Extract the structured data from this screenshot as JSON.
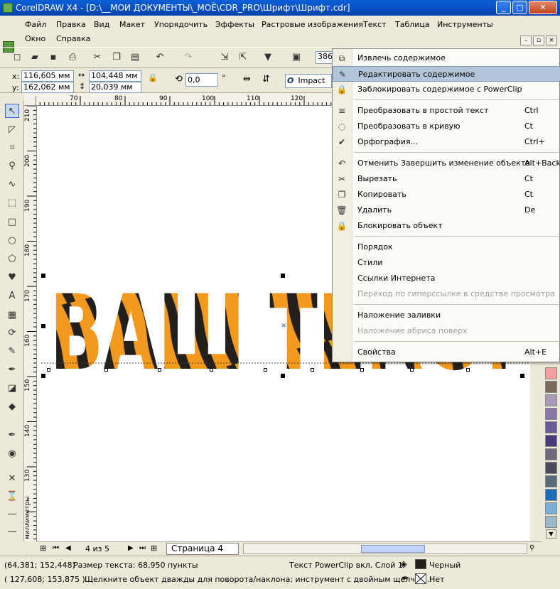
{
  "window": {
    "title": "CorelDRAW X4 - [D:\\__МОИ ДОКУМЕНТЫ\\_МОЁ\\CDR_PRO\\Шрифт\\Шрифт.cdr]"
  },
  "menu": [
    "Файл",
    "Правка",
    "Вид",
    "Макет",
    "Упорядочить",
    "Эффекты",
    "Растровые изображения",
    "Текст",
    "Таблица",
    "Инструменты",
    "Окно",
    "Справка"
  ],
  "toolbar": {
    "zoom": "386"
  },
  "props": {
    "x_label": "x:",
    "x_val": "116,605 мм",
    "y_label": "y:",
    "y_val": "162,062 мм",
    "w_val": "104,448 мм",
    "h_val": "20,039 мм",
    "angle": "0,0",
    "deg": "°",
    "font": "Impact"
  },
  "ruler": {
    "h": [
      "70",
      "80",
      "90",
      "100",
      "110",
      "120"
    ],
    "v": [
      "210",
      "200",
      "190",
      "180",
      "170",
      "160",
      "150",
      "140",
      "130"
    ],
    "unit": "миллиметры"
  },
  "canvas": {
    "text": "ВАШ ТЕКСТ"
  },
  "context_menu": [
    {
      "label": "Извлечь содержимое",
      "shortcut": "",
      "icon": "extract-icon",
      "disabled": false
    },
    {
      "label": "Редактировать содержимое",
      "shortcut": "",
      "icon": "edit-contents-icon",
      "disabled": false,
      "highlight": true
    },
    {
      "label": "Заблокировать содержимое с PowerClip",
      "shortcut": "",
      "icon": "lock-contents-icon",
      "disabled": false
    },
    {
      "sep": true
    },
    {
      "label": "Преобразовать в простой текст",
      "shortcut": "Ctrl",
      "icon": "text-convert-icon",
      "disabled": false
    },
    {
      "label": "Преобразовать в кривую",
      "shortcut": "Ct",
      "icon": "curve-icon",
      "disabled": false
    },
    {
      "label": "Орфография...",
      "shortcut": "Ctrl+",
      "icon": "spell-icon",
      "disabled": false
    },
    {
      "sep": true
    },
    {
      "label": "Отменить Завершить изменение объекта",
      "shortcut": "Alt+Backsp",
      "icon": "undo-icon",
      "disabled": false
    },
    {
      "label": "Вырезать",
      "shortcut": "Ct",
      "icon": "cut-icon",
      "disabled": false
    },
    {
      "label": "Копировать",
      "shortcut": "Ct",
      "icon": "copy-icon",
      "disabled": false
    },
    {
      "label": "Удалить",
      "shortcut": "De",
      "icon": "trash-icon",
      "disabled": false
    },
    {
      "label": "Блокировать объект",
      "shortcut": "",
      "icon": "lock-icon",
      "disabled": false
    },
    {
      "sep": true
    },
    {
      "label": "Порядок",
      "shortcut": "",
      "icon": "",
      "disabled": false
    },
    {
      "label": "Стили",
      "shortcut": "",
      "icon": "",
      "disabled": false
    },
    {
      "label": "Ссылки Интернета",
      "shortcut": "",
      "icon": "",
      "disabled": false
    },
    {
      "label": "Переход по гиперссылке в средстве просмотра",
      "shortcut": "",
      "icon": "",
      "disabled": true
    },
    {
      "sep": true
    },
    {
      "label": "Наложение заливки",
      "shortcut": "",
      "icon": "",
      "disabled": false
    },
    {
      "label": "Наложение абриса поверх",
      "shortcut": "",
      "icon": "",
      "disabled": true
    },
    {
      "sep": true
    },
    {
      "label": "Свойства",
      "shortcut": "Alt+E",
      "icon": "",
      "disabled": false
    }
  ],
  "palette": [
    "#f5a0a0",
    "#7a6a5a",
    "#a89ab8",
    "#8878a8",
    "#6a5a98",
    "#4a3a7a",
    "#6a6a7a",
    "#4a4a5a",
    "#5a6a7a",
    "#1f6ab8",
    "#7ab0d8",
    "#9ab8c8"
  ],
  "pages": {
    "counter": "4 из 5",
    "tab": "Страница 4"
  },
  "status": {
    "coords1": "(64,381; 152,448)",
    "size": "Размер текста: 68,950 пункты",
    "object": "Текст PowerClip вкл. Слой 1",
    "fill": "Черный",
    "coords2": "( 127,608; 153,875 )",
    "hint": "Щелкните объект дважды для поворота/наклона; инструмент с двойным щелчко...",
    "outline": "Нет"
  },
  "colors": {
    "tiger_orange": "#f39a1e",
    "tiger_black": "#231f1c",
    "highlight": "#b3c6d9"
  }
}
